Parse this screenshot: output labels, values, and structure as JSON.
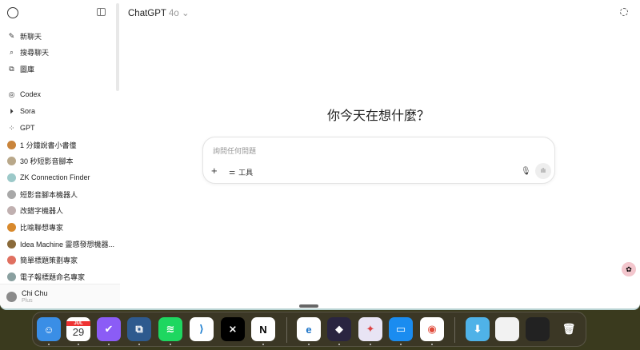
{
  "sidebar": {
    "items": [
      {
        "label": "新聊天",
        "icon": "edit-icon"
      },
      {
        "label": "搜尋聊天",
        "icon": "search-icon"
      },
      {
        "label": "圖庫",
        "icon": "images-icon"
      }
    ],
    "apps": [
      {
        "label": "Codex",
        "icon": "terminal-icon"
      },
      {
        "label": "Sora",
        "icon": "play-icon"
      },
      {
        "label": "GPT",
        "icon": "grid-icon"
      }
    ],
    "gpts": [
      {
        "label": "1 分鐘說書小書僮",
        "color": "#c9843b"
      },
      {
        "label": "30 秒短影音腳本",
        "color": "#b9a88a"
      },
      {
        "label": "ZK Connection Finder",
        "color": "#9cc9c9"
      },
      {
        "label": "短影音腳本機器人",
        "color": "#a8a8a8"
      },
      {
        "label": "改錯字機器人",
        "color": "#c0b0b0"
      },
      {
        "label": "比喻聯想專家",
        "color": "#d8892c"
      },
      {
        "label": "Idea Machine 靈感發想機器...",
        "color": "#8a6a3a"
      },
      {
        "label": "簡單標題策劃專家",
        "color": "#e07060"
      },
      {
        "label": "電子報標題命名專家",
        "color": "#8aa0a0"
      }
    ],
    "user": {
      "name": "Chi Chu",
      "plan": "Plus"
    }
  },
  "header": {
    "model": "ChatGPT",
    "version": "4o",
    "chevron": "⌄"
  },
  "main": {
    "headline": "你今天在想什麼？",
    "placeholder": "詢問任何問題",
    "tools_label": "工具"
  },
  "dock": {
    "calendar_month": "JUL",
    "calendar_day": "29",
    "apps": [
      "finder",
      "calendar",
      "omnifocus",
      "screens",
      "spotify",
      "vscode",
      "capcut",
      "notion",
      "edge",
      "obsidian",
      "craft",
      "keynote",
      "chrome",
      "downloads",
      "window-1",
      "window-2",
      "trash"
    ]
  }
}
